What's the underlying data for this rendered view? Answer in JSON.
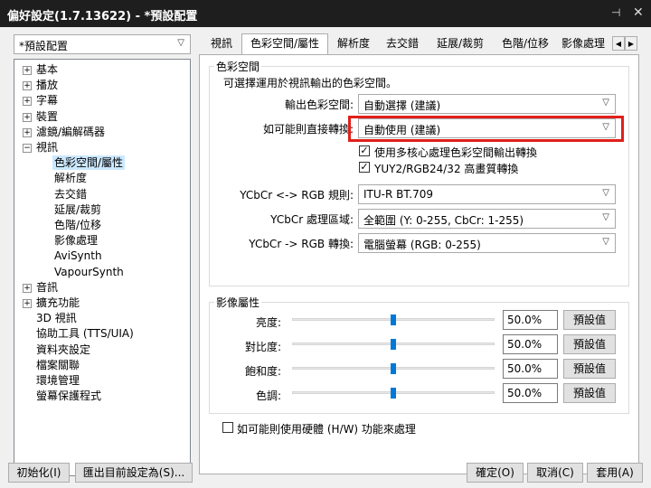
{
  "window": {
    "title": "偏好設定(1.7.13622) - *預設配置",
    "pin_icon": "pin-icon",
    "close_icon": "close-icon"
  },
  "profile": {
    "selected": "*預設配置"
  },
  "tree": [
    {
      "label": "基本",
      "expander": "+"
    },
    {
      "label": "播放",
      "expander": "+"
    },
    {
      "label": "字幕",
      "expander": "+"
    },
    {
      "label": "裝置",
      "expander": "+"
    },
    {
      "label": "濾鏡/編解碼器",
      "expander": "+"
    },
    {
      "label": "視訊",
      "expander": "-"
    },
    {
      "label": "色彩空間/屬性",
      "expander": ""
    },
    {
      "label": "解析度",
      "expander": ""
    },
    {
      "label": "去交錯",
      "expander": ""
    },
    {
      "label": "延展/裁剪",
      "expander": ""
    },
    {
      "label": "色階/位移",
      "expander": ""
    },
    {
      "label": "影像處理",
      "expander": ""
    },
    {
      "label": "AviSynth",
      "expander": ""
    },
    {
      "label": "VapourSynth",
      "expander": ""
    },
    {
      "label": "音訊",
      "expander": "+"
    },
    {
      "label": "擴充功能",
      "expander": "+"
    },
    {
      "label": "3D 視訊",
      "expander": ""
    },
    {
      "label": "協助工具 (TTS/UIA)",
      "expander": ""
    },
    {
      "label": "資料夾設定",
      "expander": ""
    },
    {
      "label": "檔案關聯",
      "expander": ""
    },
    {
      "label": "環境管理",
      "expander": ""
    },
    {
      "label": "螢幕保護程式",
      "expander": ""
    }
  ],
  "tabs": [
    "視訊",
    "色彩空間/屬性",
    "解析度",
    "去交錯",
    "延展/裁剪",
    "色階/位移",
    "影像處理"
  ],
  "colorspace": {
    "group_label": "色彩空間",
    "description": "可選擇運用於視訊輸出的色彩空間。",
    "output_label": "輸出色彩空間:",
    "output_value": "自動選擇 (建議)",
    "direct_label": "如可能則直接轉換:",
    "direct_value": "自動使用 (建議)",
    "multicore_label": "使用多核心處理色彩空間輸出轉換",
    "multicore_checked": "✓",
    "yuy2_label": "YUY2/RGB24/32 高畫質轉換",
    "yuy2_checked": "✓",
    "rule_label": "YCbCr <-> RGB 規則:",
    "rule_value": "ITU-R BT.709",
    "range_label": "YCbCr 處理區域:",
    "range_value": "全範圍 (Y: 0-255, CbCr: 1-255)",
    "convert_label": "YCbCr -> RGB 轉換:",
    "convert_value": "電腦螢幕 (RGB: 0-255)"
  },
  "image_props": {
    "group_label": "影像屬性",
    "rows": [
      {
        "label": "亮度:",
        "value": "50.0%",
        "level": 0.5,
        "button": "預設值"
      },
      {
        "label": "對比度:",
        "value": "50.0%",
        "level": 0.5,
        "button": "預設值"
      },
      {
        "label": "飽和度:",
        "value": "50.0%",
        "level": 0.5,
        "button": "預設值"
      },
      {
        "label": "色調:",
        "value": "50.0%",
        "level": 0.5,
        "button": "預設值"
      }
    ],
    "hw_label": "如可能則使用硬體 (H/W) 功能來處理"
  },
  "footer": {
    "init": "初始化(I)",
    "export": "匯出目前設定為(S)...",
    "ok": "確定(O)",
    "cancel": "取消(C)",
    "apply": "套用(A)"
  },
  "colors": {
    "highlight": "#e0201b",
    "slider_thumb": "#0078d7",
    "selected_tree": "#cce8ff"
  }
}
